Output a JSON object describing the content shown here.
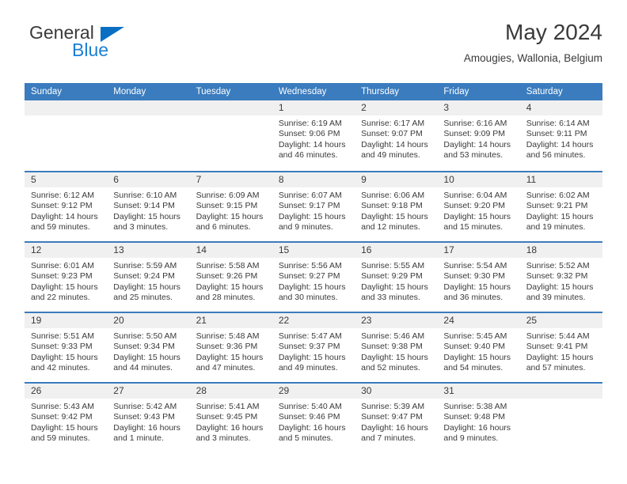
{
  "brand": {
    "name_top": "General",
    "name_bottom": "Blue",
    "triangle_color": "#0a6fc2",
    "blue_color": "#1a7fd4"
  },
  "header": {
    "title": "May 2024",
    "subtitle": "Amougies, Wallonia, Belgium"
  },
  "theme": {
    "header_band": "#3a7cbe",
    "day_band": "#f0f0f0",
    "text": "#3a3a3a"
  },
  "calendar": {
    "weekday_headers": [
      "Sunday",
      "Monday",
      "Tuesday",
      "Wednesday",
      "Thursday",
      "Friday",
      "Saturday"
    ],
    "weeks": [
      [
        {
          "day": "",
          "lines": []
        },
        {
          "day": "",
          "lines": []
        },
        {
          "day": "",
          "lines": []
        },
        {
          "day": "1",
          "lines": [
            "Sunrise: 6:19 AM",
            "Sunset: 9:06 PM",
            "Daylight: 14 hours",
            "and 46 minutes."
          ]
        },
        {
          "day": "2",
          "lines": [
            "Sunrise: 6:17 AM",
            "Sunset: 9:07 PM",
            "Daylight: 14 hours",
            "and 49 minutes."
          ]
        },
        {
          "day": "3",
          "lines": [
            "Sunrise: 6:16 AM",
            "Sunset: 9:09 PM",
            "Daylight: 14 hours",
            "and 53 minutes."
          ]
        },
        {
          "day": "4",
          "lines": [
            "Sunrise: 6:14 AM",
            "Sunset: 9:11 PM",
            "Daylight: 14 hours",
            "and 56 minutes."
          ]
        }
      ],
      [
        {
          "day": "5",
          "lines": [
            "Sunrise: 6:12 AM",
            "Sunset: 9:12 PM",
            "Daylight: 14 hours",
            "and 59 minutes."
          ]
        },
        {
          "day": "6",
          "lines": [
            "Sunrise: 6:10 AM",
            "Sunset: 9:14 PM",
            "Daylight: 15 hours",
            "and 3 minutes."
          ]
        },
        {
          "day": "7",
          "lines": [
            "Sunrise: 6:09 AM",
            "Sunset: 9:15 PM",
            "Daylight: 15 hours",
            "and 6 minutes."
          ]
        },
        {
          "day": "8",
          "lines": [
            "Sunrise: 6:07 AM",
            "Sunset: 9:17 PM",
            "Daylight: 15 hours",
            "and 9 minutes."
          ]
        },
        {
          "day": "9",
          "lines": [
            "Sunrise: 6:06 AM",
            "Sunset: 9:18 PM",
            "Daylight: 15 hours",
            "and 12 minutes."
          ]
        },
        {
          "day": "10",
          "lines": [
            "Sunrise: 6:04 AM",
            "Sunset: 9:20 PM",
            "Daylight: 15 hours",
            "and 15 minutes."
          ]
        },
        {
          "day": "11",
          "lines": [
            "Sunrise: 6:02 AM",
            "Sunset: 9:21 PM",
            "Daylight: 15 hours",
            "and 19 minutes."
          ]
        }
      ],
      [
        {
          "day": "12",
          "lines": [
            "Sunrise: 6:01 AM",
            "Sunset: 9:23 PM",
            "Daylight: 15 hours",
            "and 22 minutes."
          ]
        },
        {
          "day": "13",
          "lines": [
            "Sunrise: 5:59 AM",
            "Sunset: 9:24 PM",
            "Daylight: 15 hours",
            "and 25 minutes."
          ]
        },
        {
          "day": "14",
          "lines": [
            "Sunrise: 5:58 AM",
            "Sunset: 9:26 PM",
            "Daylight: 15 hours",
            "and 28 minutes."
          ]
        },
        {
          "day": "15",
          "lines": [
            "Sunrise: 5:56 AM",
            "Sunset: 9:27 PM",
            "Daylight: 15 hours",
            "and 30 minutes."
          ]
        },
        {
          "day": "16",
          "lines": [
            "Sunrise: 5:55 AM",
            "Sunset: 9:29 PM",
            "Daylight: 15 hours",
            "and 33 minutes."
          ]
        },
        {
          "day": "17",
          "lines": [
            "Sunrise: 5:54 AM",
            "Sunset: 9:30 PM",
            "Daylight: 15 hours",
            "and 36 minutes."
          ]
        },
        {
          "day": "18",
          "lines": [
            "Sunrise: 5:52 AM",
            "Sunset: 9:32 PM",
            "Daylight: 15 hours",
            "and 39 minutes."
          ]
        }
      ],
      [
        {
          "day": "19",
          "lines": [
            "Sunrise: 5:51 AM",
            "Sunset: 9:33 PM",
            "Daylight: 15 hours",
            "and 42 minutes."
          ]
        },
        {
          "day": "20",
          "lines": [
            "Sunrise: 5:50 AM",
            "Sunset: 9:34 PM",
            "Daylight: 15 hours",
            "and 44 minutes."
          ]
        },
        {
          "day": "21",
          "lines": [
            "Sunrise: 5:48 AM",
            "Sunset: 9:36 PM",
            "Daylight: 15 hours",
            "and 47 minutes."
          ]
        },
        {
          "day": "22",
          "lines": [
            "Sunrise: 5:47 AM",
            "Sunset: 9:37 PM",
            "Daylight: 15 hours",
            "and 49 minutes."
          ]
        },
        {
          "day": "23",
          "lines": [
            "Sunrise: 5:46 AM",
            "Sunset: 9:38 PM",
            "Daylight: 15 hours",
            "and 52 minutes."
          ]
        },
        {
          "day": "24",
          "lines": [
            "Sunrise: 5:45 AM",
            "Sunset: 9:40 PM",
            "Daylight: 15 hours",
            "and 54 minutes."
          ]
        },
        {
          "day": "25",
          "lines": [
            "Sunrise: 5:44 AM",
            "Sunset: 9:41 PM",
            "Daylight: 15 hours",
            "and 57 minutes."
          ]
        }
      ],
      [
        {
          "day": "26",
          "lines": [
            "Sunrise: 5:43 AM",
            "Sunset: 9:42 PM",
            "Daylight: 15 hours",
            "and 59 minutes."
          ]
        },
        {
          "day": "27",
          "lines": [
            "Sunrise: 5:42 AM",
            "Sunset: 9:43 PM",
            "Daylight: 16 hours",
            "and 1 minute."
          ]
        },
        {
          "day": "28",
          "lines": [
            "Sunrise: 5:41 AM",
            "Sunset: 9:45 PM",
            "Daylight: 16 hours",
            "and 3 minutes."
          ]
        },
        {
          "day": "29",
          "lines": [
            "Sunrise: 5:40 AM",
            "Sunset: 9:46 PM",
            "Daylight: 16 hours",
            "and 5 minutes."
          ]
        },
        {
          "day": "30",
          "lines": [
            "Sunrise: 5:39 AM",
            "Sunset: 9:47 PM",
            "Daylight: 16 hours",
            "and 7 minutes."
          ]
        },
        {
          "day": "31",
          "lines": [
            "Sunrise: 5:38 AM",
            "Sunset: 9:48 PM",
            "Daylight: 16 hours",
            "and 9 minutes."
          ]
        },
        {
          "day": "",
          "lines": []
        }
      ]
    ]
  }
}
